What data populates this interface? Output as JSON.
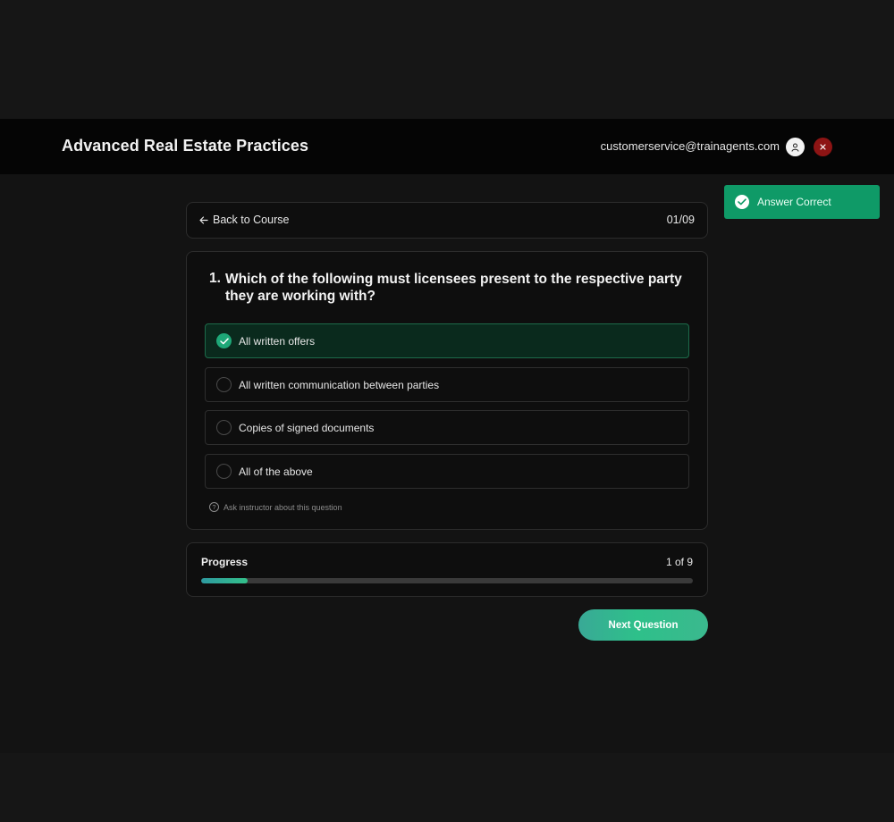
{
  "header": {
    "title": "Advanced Real Estate Practices",
    "email": "customerservice@trainagents.com",
    "avatar_icon": "user-icon",
    "close_icon": "close-icon",
    "close_color": "#8d1414"
  },
  "nav": {
    "back_label": "Back to Course",
    "back_icon": "arrow-left-icon",
    "counter": "01/09"
  },
  "question": {
    "number": "1.",
    "text": "Which of the following must licensees present to the respective party they are working with?",
    "options": [
      {
        "label": "All written offers",
        "selected": true
      },
      {
        "label": "All written communication between parties",
        "selected": false
      },
      {
        "label": "Copies of signed documents",
        "selected": false
      },
      {
        "label": "All of the above",
        "selected": false
      }
    ],
    "ask_label": "Ask instructor about this question",
    "ask_icon": "question-circle-icon"
  },
  "progress": {
    "label": "Progress",
    "count_text": "1 of 9",
    "fraction": 0.0945
  },
  "next_button": {
    "label": "Next Question"
  },
  "toast": {
    "text": "Answer Correct",
    "icon": "check-circle-icon",
    "color": "#0f9a67"
  },
  "colors": {
    "accent": "#1ea878",
    "background": "#131313",
    "card": "#0e0e0e"
  }
}
